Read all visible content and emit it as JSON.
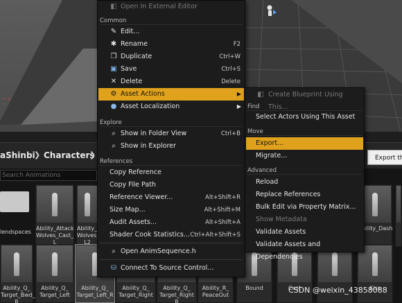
{
  "breadcrumb": {
    "parent": "aShinbi",
    "current": "Characters",
    "sep": "❯"
  },
  "search": {
    "placeholder": "Search Animations"
  },
  "tooltip": {
    "text": "Export the"
  },
  "watermark": {
    "text": "CSDN @weixin_43858088"
  },
  "folder": {
    "label": "lendspaces"
  },
  "tiles_top": [
    {
      "label": "Ability_Attack\nWolves_Cast_\nL"
    },
    {
      "label": "Ability_A\nWolves_\nL2"
    },
    {
      "label": ""
    },
    {
      "label": ""
    },
    {
      "label": "Ability_Dash"
    }
  ],
  "tiles_bottom": [
    {
      "label": "Ability_Q_\nTarget_Bwd_\nR"
    },
    {
      "label": "Ability_Q_\nTarget_Left"
    },
    {
      "label": "Ability_Q_\nTarget_Left_R"
    },
    {
      "label": "Ability_Q_\nTarget_Right"
    },
    {
      "label": "Ability_Q_\nTarget_Right\nR"
    },
    {
      "label": "Ability_R_\nPeaceOut"
    },
    {
      "label": "Bound"
    },
    {
      "label": "Cast"
    },
    {
      "label": ""
    },
    {
      "label": "Kiss"
    }
  ],
  "context_menu": {
    "top_item": "Open In External Editor",
    "section_common": "Common",
    "edit": "Edit...",
    "rename": "Rename",
    "rename_sc": "F2",
    "duplicate": "Duplicate",
    "duplicate_sc": "Ctrl+W",
    "save": "Save",
    "save_sc": "Ctrl+S",
    "delete": "Delete",
    "delete_sc": "Delete",
    "asset_actions": "Asset Actions",
    "asset_localization": "Asset Localization",
    "section_explore": "Explore",
    "show_folder": "Show in Folder View",
    "show_folder_sc": "Ctrl+B",
    "show_explorer": "Show in Explorer",
    "section_references": "References",
    "copy_reference": "Copy Reference",
    "copy_file_path": "Copy File Path",
    "reference_viewer": "Reference Viewer...",
    "reference_viewer_sc": "Alt+Shift+R",
    "size_map": "Size Map...",
    "size_map_sc": "Alt+Shift+M",
    "audit_assets": "Audit Assets...",
    "audit_assets_sc": "Alt+Shift+A",
    "shader_cook": "Shader Cook Statistics...",
    "shader_cook_sc": "Ctrl+Alt+Shift+S",
    "open_header": "Open AnimSequence.h",
    "connect_source": "Connect To Source Control..."
  },
  "submenu": {
    "create_blueprint": "Create Blueprint Using This...",
    "section_find": "Find",
    "select_actors": "Select Actors Using This Asset",
    "section_move": "Move",
    "export": "Export...",
    "migrate": "Migrate...",
    "section_advanced": "Advanced",
    "reload": "Reload",
    "replace_refs": "Replace References",
    "bulk_edit": "Bulk Edit via Property Matrix...",
    "show_metadata": "Show Metadata",
    "validate": "Validate Assets",
    "validate_deps": "Validate Assets and Dependencies"
  },
  "colors": {
    "highlight": "#e0a21c",
    "menu_bg": "#1c1c1c"
  }
}
